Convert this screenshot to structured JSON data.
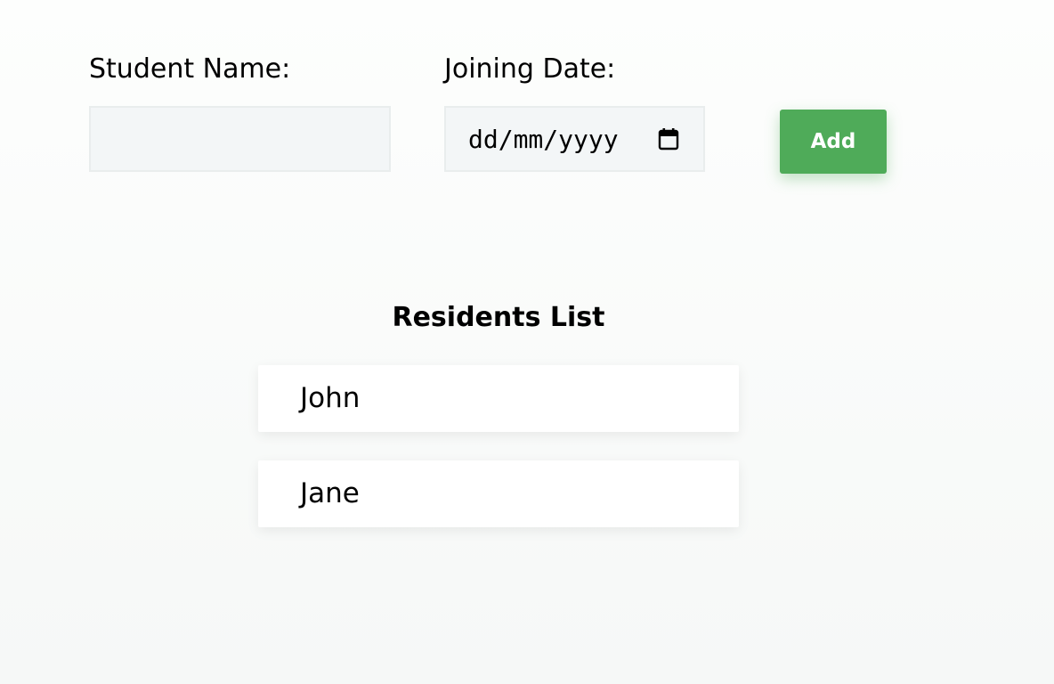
{
  "form": {
    "name_label": "Student Name:",
    "name_value": "",
    "date_label": "Joining Date:",
    "date_placeholder": "dd/mm/yyyy",
    "add_label": "Add"
  },
  "list": {
    "title": "Residents List",
    "residents": [
      "John",
      "Jane"
    ]
  },
  "colors": {
    "accent": "#4fab59",
    "input_background": "#f3f6f7"
  },
  "icons": {
    "date_picker": "calendar-icon"
  }
}
